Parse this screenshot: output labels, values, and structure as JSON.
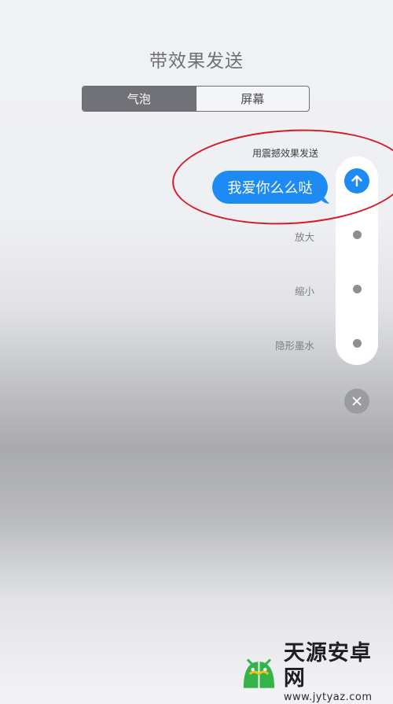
{
  "header": {
    "title": "带效果发送"
  },
  "segmented": {
    "bubble_tab": "气泡",
    "screen_tab": "屏幕",
    "selected": "气泡"
  },
  "preview": {
    "effect_caption": "用震撼效果发送",
    "message": "我爱你么么哒"
  },
  "effects": [
    {
      "label": "放大"
    },
    {
      "label": "缩小"
    },
    {
      "label": "隐形墨水"
    }
  ],
  "icons": {
    "send": "arrow-up-icon",
    "cancel": "close-icon"
  },
  "colors": {
    "accent": "#1d8bf3",
    "annotation": "#d21c2b",
    "segment_active": "#707277"
  },
  "watermark": {
    "name": "天源安卓网",
    "url": "www.jytyaz.com"
  }
}
